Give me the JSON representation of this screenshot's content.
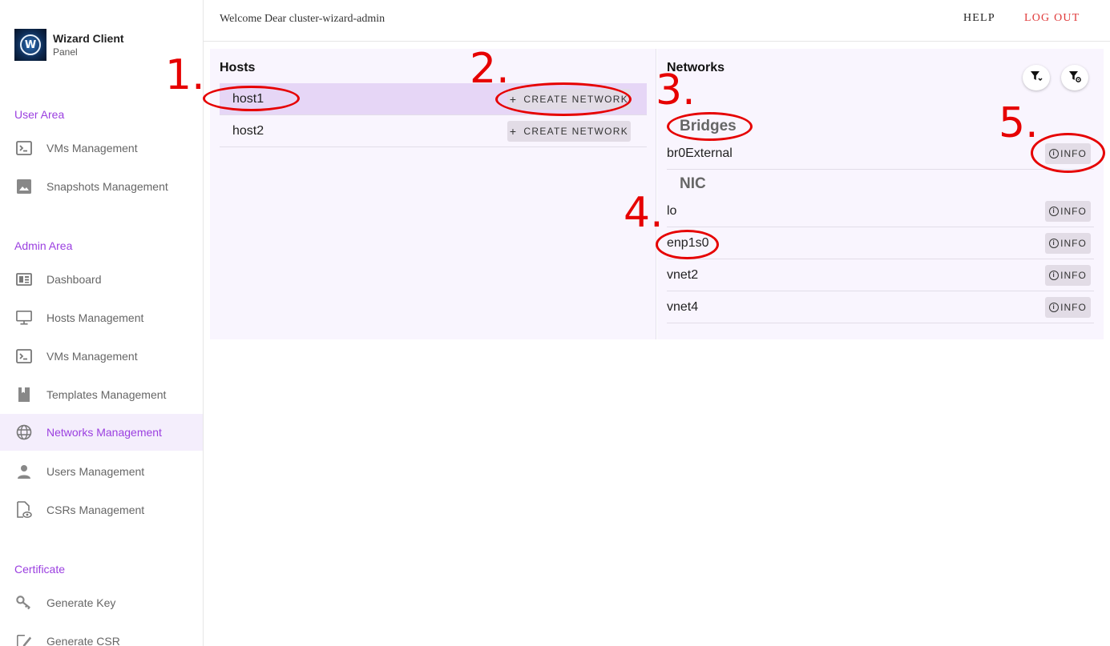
{
  "brand": {
    "title": "Wizard Client",
    "subtitle": "Panel",
    "logo_letter": "W"
  },
  "sidebar": {
    "sections": [
      {
        "title": "User Area"
      },
      {
        "title": "Admin Area"
      },
      {
        "title": "Certificate"
      }
    ],
    "items": [
      {
        "label": "VMs Management",
        "icon": "terminal-icon"
      },
      {
        "label": "Snapshots Management",
        "icon": "image-icon"
      },
      {
        "label": "Dashboard",
        "icon": "dashboard-icon"
      },
      {
        "label": "Hosts Management",
        "icon": "monitor-icon"
      },
      {
        "label": "VMs Management",
        "icon": "terminal-icon"
      },
      {
        "label": "Templates Management",
        "icon": "bookmark-icon"
      },
      {
        "label": "Networks Management",
        "icon": "globe-icon",
        "active": true
      },
      {
        "label": "Users Management",
        "icon": "person-icon"
      },
      {
        "label": "CSRs Management",
        "icon": "document-eye-icon"
      },
      {
        "label": "Generate Key",
        "icon": "key-icon"
      },
      {
        "label": "Generate CSR",
        "icon": "edit-document-icon"
      }
    ]
  },
  "header": {
    "welcome": "Welcome Dear cluster-wizard-admin",
    "help": "HELP",
    "logout": "LOG OUT"
  },
  "hosts": {
    "title": "Hosts",
    "create_label": "CREATE NETWORK",
    "rows": [
      {
        "name": "host1",
        "selected": true
      },
      {
        "name": "host2",
        "selected": false
      }
    ]
  },
  "networks": {
    "title": "Networks",
    "info_label": "INFO",
    "bridges_label": "Bridges",
    "nic_label": "NIC",
    "bridges": [
      {
        "name": "br0External"
      }
    ],
    "nics": [
      {
        "name": "lo"
      },
      {
        "name": "enp1s0"
      },
      {
        "name": "vnet2"
      },
      {
        "name": "vnet4"
      }
    ]
  },
  "annotations": [
    "1.",
    "2.",
    "3.",
    "4.",
    "5."
  ],
  "colors": {
    "accent": "#9b3fe0",
    "logout": "#e03a3a",
    "annotation": "#e60000",
    "selected_row": "#e6d6f6",
    "panel_bg": "#f9f5fe"
  }
}
